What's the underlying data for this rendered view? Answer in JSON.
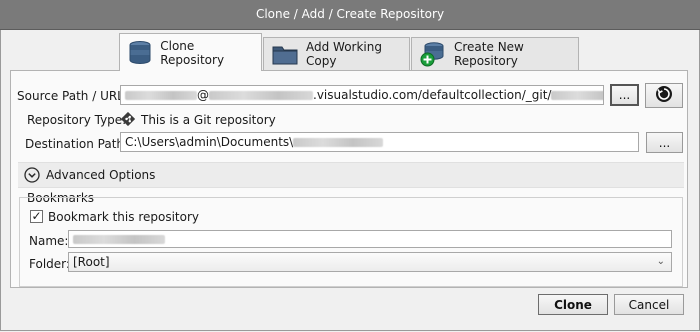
{
  "window": {
    "title": "Clone / Add / Create Repository"
  },
  "tabs": [
    {
      "label": "Clone Repository",
      "icon": "database-stack-icon",
      "active": true
    },
    {
      "label": "Add Working Copy",
      "icon": "folder-icon",
      "active": false
    },
    {
      "label": "Create New Repository",
      "icon": "database-add-icon",
      "active": false
    }
  ],
  "form": {
    "source_label": "Source Path / URL:",
    "source_value_visible": "@",
    "source_value_visible2": ".visualstudio.com/defaultcollection/_git/",
    "browse_label": "...",
    "repo_type_label": "Repository Type:",
    "repo_type_value": "This is a Git repository",
    "dest_label": "Destination Path:",
    "dest_value": "C:\\Users\\admin\\Documents\\",
    "dest_browse_label": "...",
    "advanced_label": "Advanced Options"
  },
  "bookmarks": {
    "group_label": "Bookmarks",
    "checkbox_label": "Bookmark this repository",
    "checked": true,
    "check_glyph": "✓",
    "name_label": "Name:",
    "folder_label": "Folder:",
    "folder_value": "[Root]"
  },
  "actions": {
    "clone_label": "Clone",
    "cancel_label": "Cancel"
  },
  "colors": {
    "titlebar": "#7a7a7a",
    "git_badge": "#3a3a3a",
    "db_blue": "#3b5d82",
    "add_green": "#1a9e3a"
  }
}
